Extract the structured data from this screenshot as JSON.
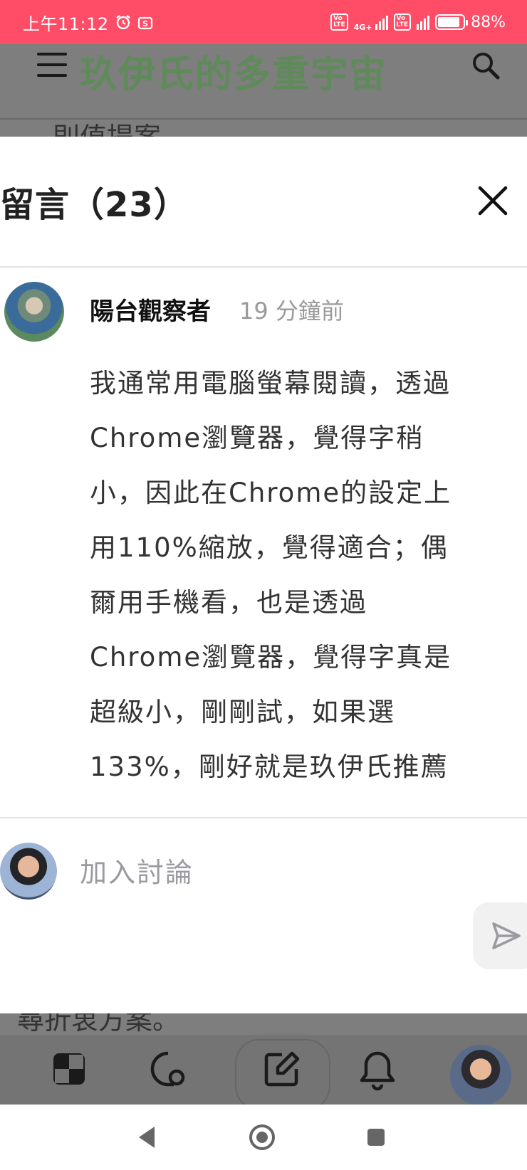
{
  "status_bar": {
    "time": "上午11:12",
    "network": "4G+",
    "lte_badge": "Vo LTE",
    "battery": "88%",
    "battery_level": 0.88
  },
  "app_header": {
    "logo_text": "玖伊氏的多重宇宙",
    "snippet_top": "則值提案。",
    "icons": [
      "menu-icon",
      "search-icon"
    ]
  },
  "sheet": {
    "title": "留言（23）",
    "comment": {
      "author": "陽台觀察者",
      "time": "19 分鐘前",
      "lines": [
        "我通常用電腦螢幕閱讀，透過",
        "Chrome瀏覽器，覺得字稍",
        "小，因此在Chrome的設定上",
        "用110%縮放，覺得適合；偶",
        "爾用手機看，也是透過",
        "Chrome瀏覽器，覺得字真是",
        "超級小，剛剛試，如果選",
        "133%，剛好就是玖伊氏推薦"
      ]
    },
    "compose": {
      "placeholder": "加入討論"
    }
  },
  "app_bottom": {
    "snippet_bottom": "尋折衷方案。",
    "nav_icons": [
      "home-icon",
      "chat-search-icon",
      "write-icon",
      "bell-icon",
      "profile-avatar"
    ]
  },
  "system_nav": [
    "back-icon",
    "home-circle-icon",
    "recents-icon"
  ],
  "colors": {
    "status_bar": "#ff4d67",
    "dim_overlay": "#7e7e7e"
  }
}
